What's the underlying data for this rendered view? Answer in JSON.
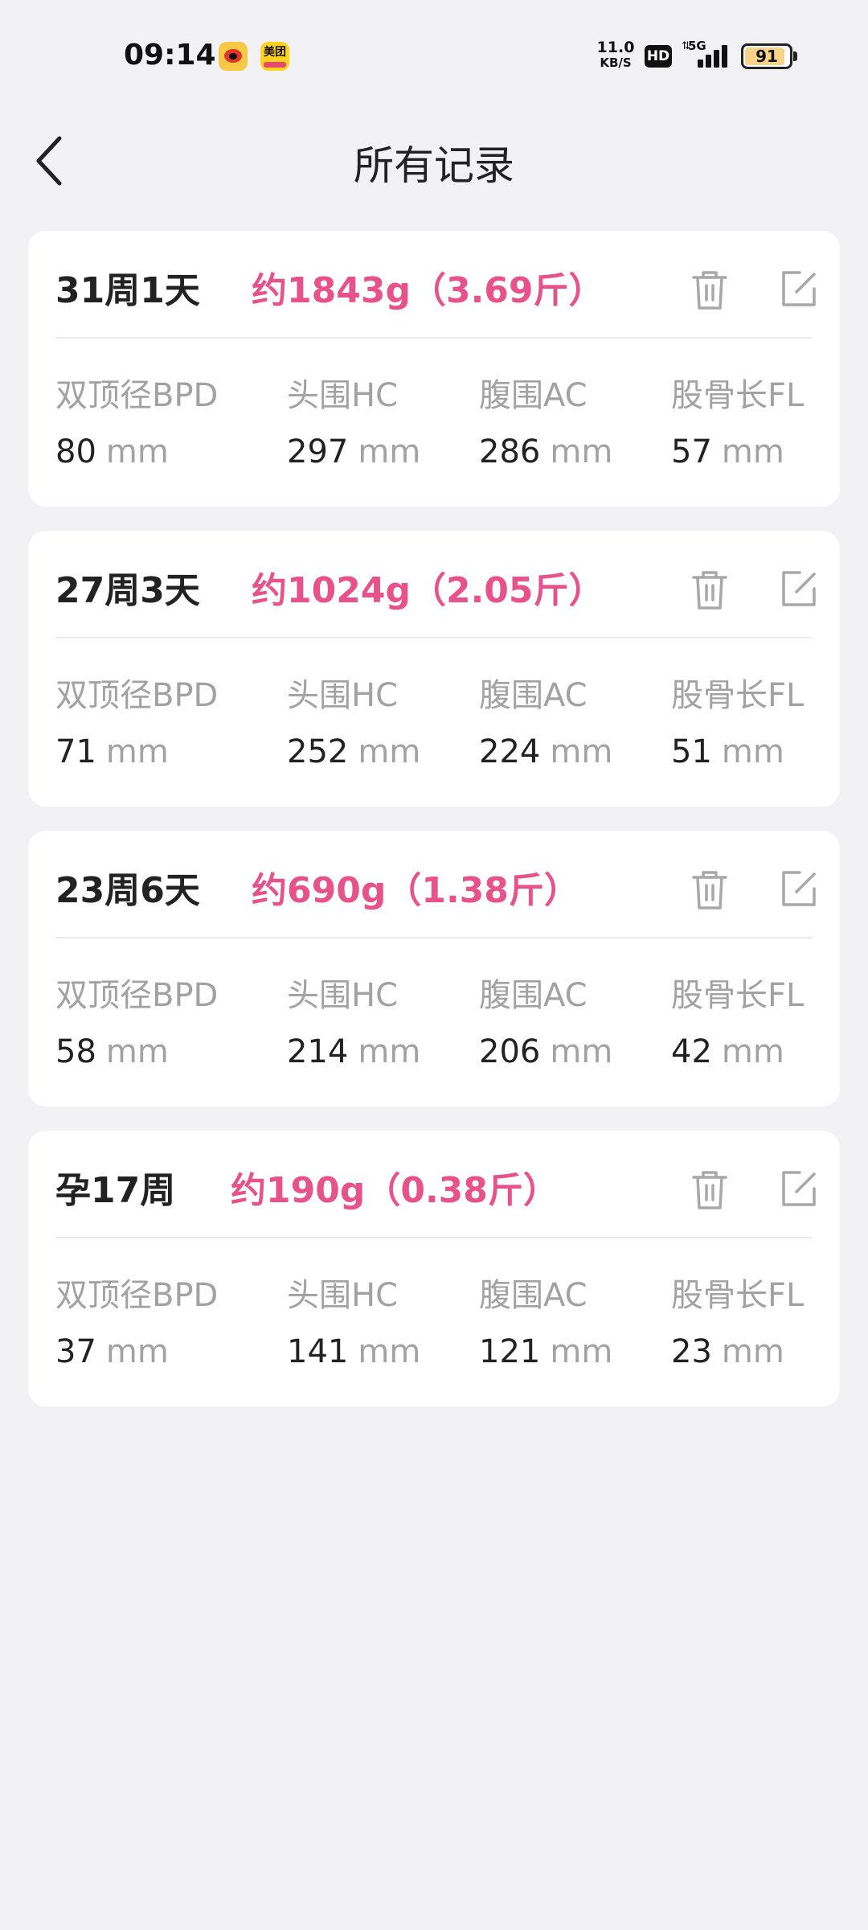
{
  "status_bar": {
    "time": "09:14",
    "net_speed_value": "11.0",
    "net_speed_unit": "KB/S",
    "hd_label": "HD",
    "network_type": "5G",
    "battery_level": "91",
    "battery_fraction": 0.91,
    "app_icons": [
      "weibo-icon",
      "meituan-icon"
    ],
    "meituan_label": "美团"
  },
  "header": {
    "title": "所有记录",
    "back_icon": "chevron-left-icon"
  },
  "colors": {
    "background": "#f2f2f5",
    "card": "#ffffff",
    "accent_pink": "#e8528a",
    "label_gray": "#a2a2a2",
    "text_dark": "#222222"
  },
  "records": [
    {
      "week": "31周1天",
      "weight": "约1843g（3.69斤）",
      "metrics": [
        {
          "label": "双顶径BPD",
          "value": "80",
          "unit": "mm"
        },
        {
          "label": "头围HC",
          "value": "297",
          "unit": "mm"
        },
        {
          "label": "腹围AC",
          "value": "286",
          "unit": "mm"
        },
        {
          "label": "股骨长FL",
          "value": "57",
          "unit": "mm"
        }
      ]
    },
    {
      "week": "27周3天",
      "weight": "约1024g（2.05斤）",
      "metrics": [
        {
          "label": "双顶径BPD",
          "value": "71",
          "unit": "mm"
        },
        {
          "label": "头围HC",
          "value": "252",
          "unit": "mm"
        },
        {
          "label": "腹围AC",
          "value": "224",
          "unit": "mm"
        },
        {
          "label": "股骨长FL",
          "value": "51",
          "unit": "mm"
        }
      ]
    },
    {
      "week": "23周6天",
      "weight": "约690g（1.38斤）",
      "metrics": [
        {
          "label": "双顶径BPD",
          "value": "58",
          "unit": "mm"
        },
        {
          "label": "头围HC",
          "value": "214",
          "unit": "mm"
        },
        {
          "label": "腹围AC",
          "value": "206",
          "unit": "mm"
        },
        {
          "label": "股骨长FL",
          "value": "42",
          "unit": "mm"
        }
      ]
    },
    {
      "week": "孕17周",
      "weight": "约190g（0.38斤）",
      "metrics": [
        {
          "label": "双顶径BPD",
          "value": "37",
          "unit": "mm"
        },
        {
          "label": "头围HC",
          "value": "141",
          "unit": "mm"
        },
        {
          "label": "腹围AC",
          "value": "121",
          "unit": "mm"
        },
        {
          "label": "股骨长FL",
          "value": "23",
          "unit": "mm"
        }
      ]
    }
  ]
}
